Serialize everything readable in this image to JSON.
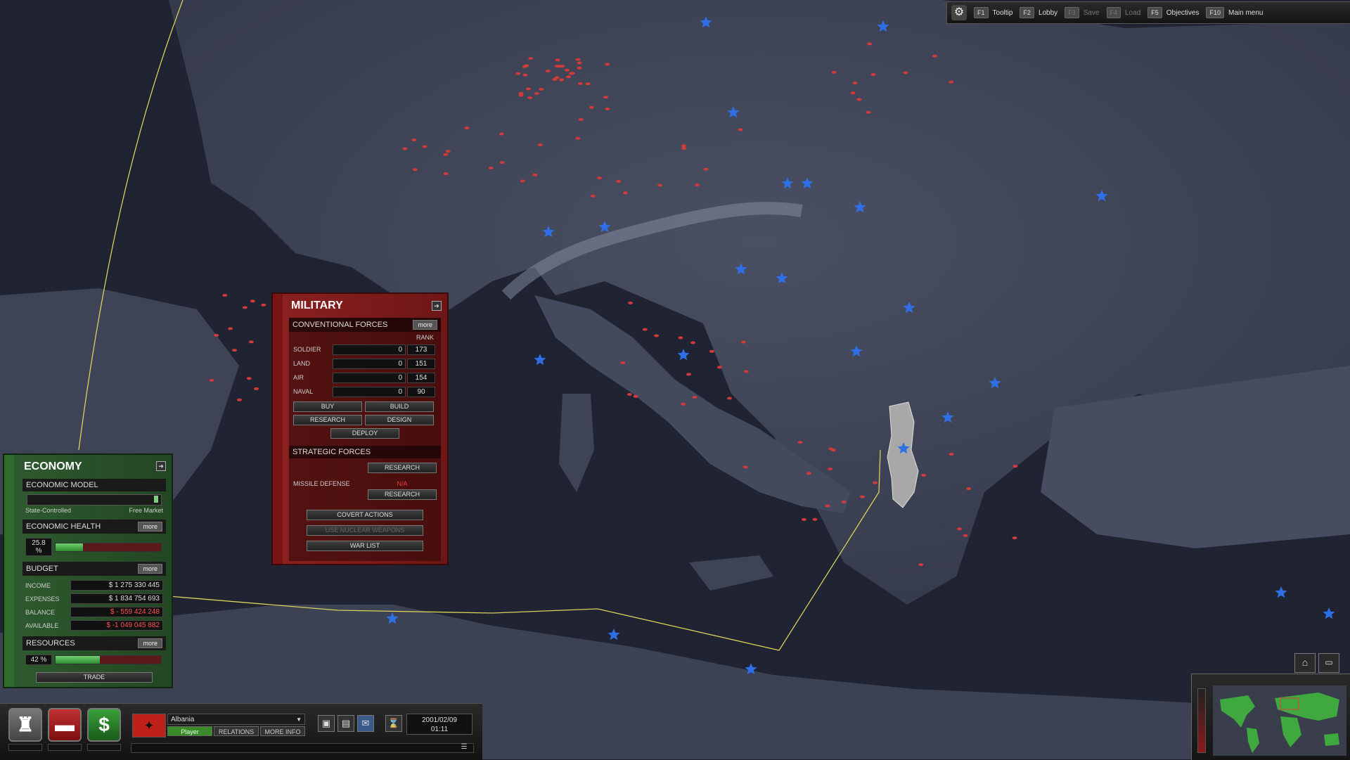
{
  "toolbar": {
    "items": [
      {
        "key": "F1",
        "label": "Tooltip"
      },
      {
        "key": "F2",
        "label": "Lobby"
      },
      {
        "key": "F3",
        "label": "Save"
      },
      {
        "key": "F4",
        "label": "Load"
      },
      {
        "key": "F5",
        "label": "Objectives"
      },
      {
        "key": "F10",
        "label": "Main menu"
      }
    ]
  },
  "military": {
    "title": "MILITARY",
    "conventional": {
      "heading": "CONVENTIONAL FORCES",
      "more": "more",
      "rank_label": "RANK",
      "rows": [
        {
          "label": "SOLDIER",
          "value": "0",
          "rank": "173"
        },
        {
          "label": "LAND",
          "value": "0",
          "rank": "151"
        },
        {
          "label": "AIR",
          "value": "0",
          "rank": "154"
        },
        {
          "label": "NAVAL",
          "value": "0",
          "rank": "90"
        }
      ],
      "buy": "BUY",
      "build": "BUILD",
      "research": "RESEARCH",
      "design": "DESIGN",
      "deploy": "DEPLOY"
    },
    "strategic": {
      "heading": "STRATEGIC FORCES",
      "research": "RESEARCH",
      "missile_defense_label": "MISSILE DEFENSE",
      "missile_defense_value": "N/A",
      "missile_research": "RESEARCH"
    },
    "covert_actions": "COVERT ACTIONS",
    "use_nuclear": "USE NUCLEAR WEAPONS",
    "war_list": "WAR LIST"
  },
  "economy": {
    "title": "ECONOMY",
    "model_heading": "ECONOMIC MODEL",
    "model_left": "State-Controlled",
    "model_right": "Free Market",
    "model_position": 0.98,
    "health_heading": "ECONOMIC HEALTH",
    "health_more": "more",
    "health_value": "25.8 %",
    "health_fraction": 0.258,
    "budget_heading": "BUDGET",
    "budget_more": "more",
    "budget_rows": [
      {
        "label": "INCOME",
        "value": "$ 1 275 330 445",
        "negative": false
      },
      {
        "label": "EXPENSES",
        "value": "$ 1 834 754 693",
        "negative": false
      },
      {
        "label": "BALANCE",
        "value": "$ - 559 424 248",
        "negative": true
      },
      {
        "label": "AVAILABLE",
        "value": "$ -1 049 045 882",
        "negative": true
      }
    ],
    "resources_heading": "RESOURCES",
    "resources_more": "more",
    "resources_value": "42 %",
    "resources_fraction": 0.42,
    "trade": "TRADE"
  },
  "bottom": {
    "country": "Albania",
    "player_tab": "Player",
    "relations_tab": "RELATIONS",
    "more_info_tab": "MORE INFO",
    "date": "2001/02/09",
    "time": "01:11"
  },
  "colors": {
    "military_red": "#8a2020",
    "economy_green": "#2e5a2e",
    "ally_star": "#2f6fe6",
    "unit_red": "#d13a3a",
    "border_line": "#d9d15a"
  }
}
